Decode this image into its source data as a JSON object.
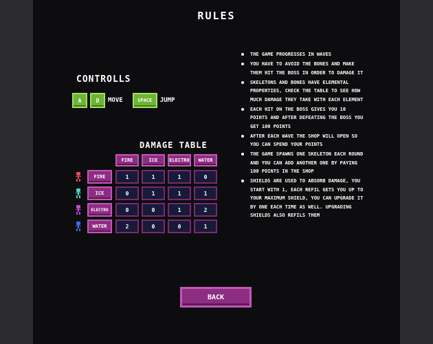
{
  "title": "RULES",
  "controls": {
    "title": "CONTROLLS",
    "key_a": "A",
    "key_d": "D",
    "move_label": "MOVE",
    "key_space": "SPACE",
    "jump_label": "JUMP"
  },
  "damage_table": {
    "title": "DAMAGE TABLE",
    "columns": [
      "FIRE",
      "ICE",
      "ELECTRO",
      "WATER"
    ],
    "rows": [
      {
        "label": "FIRE",
        "skeleton_color": "#e04a5a",
        "values": [
          "1",
          "1",
          "1",
          "0"
        ]
      },
      {
        "label": "ICE",
        "skeleton_color": "#55d0c0",
        "values": [
          "0",
          "1",
          "1",
          "1"
        ]
      },
      {
        "label": "ELECTRO",
        "skeleton_color": "#c04ad0",
        "values": [
          "0",
          "0",
          "1",
          "2"
        ]
      },
      {
        "label": "WATER",
        "skeleton_color": "#3d6fe0",
        "values": [
          "2",
          "0",
          "0",
          "1"
        ]
      }
    ]
  },
  "rules": [
    "The game progresses in waves",
    "You have to avoid the bones and make them hit the boss in order to damage it",
    "Skeletons and bones have elemental properties, check the table to see how much damage they take with each element",
    "Each hit on the boss gives you 10 points and after defeating the boss you get 100 points",
    "After each wave the shop will open so you can spend your points",
    "The game spawns one skeleton each round and you can add another one by paying 100 points in the shop",
    "Shields are used to absorb damage, you start with 1, each refil gets you up to your maximum shield, you can upgrade it by one each time as well. Upgrading shields also refils them"
  ],
  "back_button": "BACK",
  "colors": {
    "background": "#0d0d0f",
    "side_panel": "#2b2b30",
    "button_fill": "#8d2d82",
    "button_border": "#c356b7",
    "cell_fill": "#171a38",
    "key_fill": "#6fb434"
  }
}
